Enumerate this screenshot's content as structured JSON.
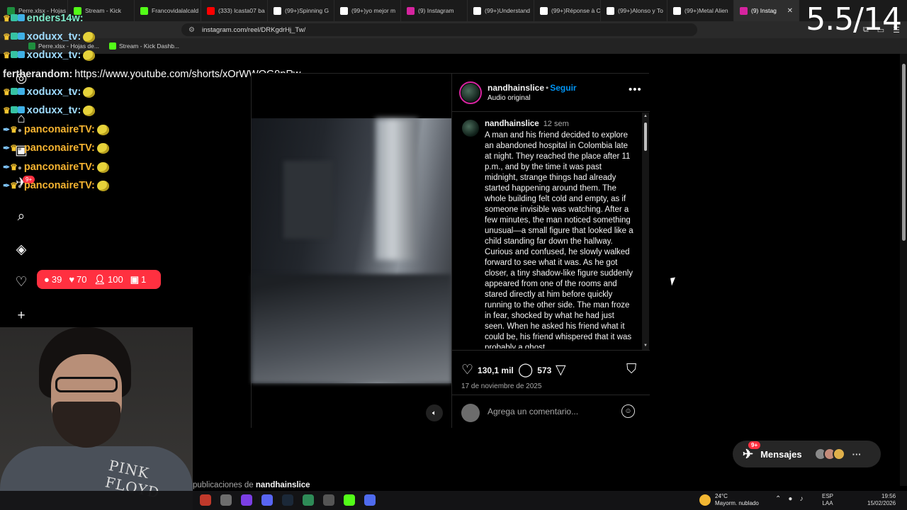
{
  "browser": {
    "tabs": [
      {
        "label": "Perre.xlsx - Hojas",
        "color": "#1e8e3e"
      },
      {
        "label": "Stream - Kick",
        "color": "#53fc18"
      },
      {
        "label": "Francovidalalcald",
        "color": "#53fc18"
      },
      {
        "label": "(333) lcasta07 ba",
        "color": "#ff0000"
      },
      {
        "label": "(99+)Spinning G",
        "color": "#ffffff"
      },
      {
        "label": "(99+)yo mejor m",
        "color": "#ffffff"
      },
      {
        "label": "(9) Instagram",
        "color": "#d6249f"
      },
      {
        "label": "(99+)Understand",
        "color": "#ffffff"
      },
      {
        "label": "(99+)Réponse à C",
        "color": "#ffffff"
      },
      {
        "label": "(99+)Alonso y To",
        "color": "#ffffff"
      },
      {
        "label": "(99+)Metal Alien",
        "color": "#ffffff"
      },
      {
        "label": "(9) Instag",
        "color": "#d6249f",
        "active": true
      }
    ],
    "url": "instagram.com/reel/DRKgdrHj_Tw/",
    "bookmarks": [
      {
        "label": "Perre.xlsx - Hojas de...",
        "color": "#1e8e3e"
      },
      {
        "label": "Stream - Kick Dashb...",
        "color": "#53fc18"
      }
    ]
  },
  "overlay": {
    "counter": "5.5/14"
  },
  "chat": [
    {
      "user": "enders14w:",
      "style": "teal",
      "msg": ""
    },
    {
      "user": "xoduxx_tv:",
      "style": "blue",
      "msg": ""
    },
    {
      "user": "xoduxx_tv:",
      "style": "blue",
      "msg": ""
    },
    {
      "user": "fertherandom:",
      "style": "white",
      "msg": "https://www.youtube.com/shorts/xOrWWOG9pRw"
    },
    {
      "user": "xoduxx_tv:",
      "style": "blue",
      "msg": ""
    },
    {
      "user": "xoduxx_tv:",
      "style": "blue",
      "msg": ""
    },
    {
      "user": "panconaireTV:",
      "style": "orange",
      "msg": ""
    },
    {
      "user": "panconaireTV:",
      "style": "orange",
      "msg": ""
    },
    {
      "user": "panconaireTV:",
      "style": "orange",
      "msg": ""
    },
    {
      "user": "panconaireTV:",
      "style": "orange",
      "msg": ""
    }
  ],
  "sidebar": {
    "notif_badge": "9+",
    "notifications": {
      "comments": "39",
      "likes": "70",
      "followers": "100",
      "other": "1"
    }
  },
  "post": {
    "username": "nandhainslice",
    "follow_label": "Seguir",
    "audio": "Audio original",
    "caption_user": "nandhainslice",
    "caption_time": "12 sem",
    "caption": "A man and his friend decided to explore an abandoned hospital in Colombia late at night. They reached the place after 11 p.m., and by the time it was past midnight, strange things had already started happening around them. The whole building felt cold and empty, as if someone invisible was watching. After a few minutes, the man noticed something unusual—a small figure that looked like a child standing far down the hallway. Curious and confused, he slowly walked forward to see what it was. As he got closer, a tiny shadow-like figure suddenly appeared from one of the rooms and stared directly at him before quickly running to the other side. The man froze in fear, shocked by what he had just seen. When he asked his friend what it could be, his friend whispered that it was probably a ghost",
    "likes": "130,1 mil",
    "comments": "573",
    "date": "17 de noviembre de 2025",
    "comment_placeholder": "Agrega un comentario..."
  },
  "below": {
    "prefix": "publicaciones de",
    "user": "nandhainslice"
  },
  "messages": {
    "label": "Mensajes",
    "badge": "9+"
  },
  "webcam": {
    "shirt_print": "PINK FLOYD"
  },
  "taskbar": {
    "temp": "24°C",
    "weather": "Mayorm. nublado",
    "lang1": "ESP",
    "lang2": "LAA",
    "time": "19:56",
    "date": "15/02/2026"
  }
}
